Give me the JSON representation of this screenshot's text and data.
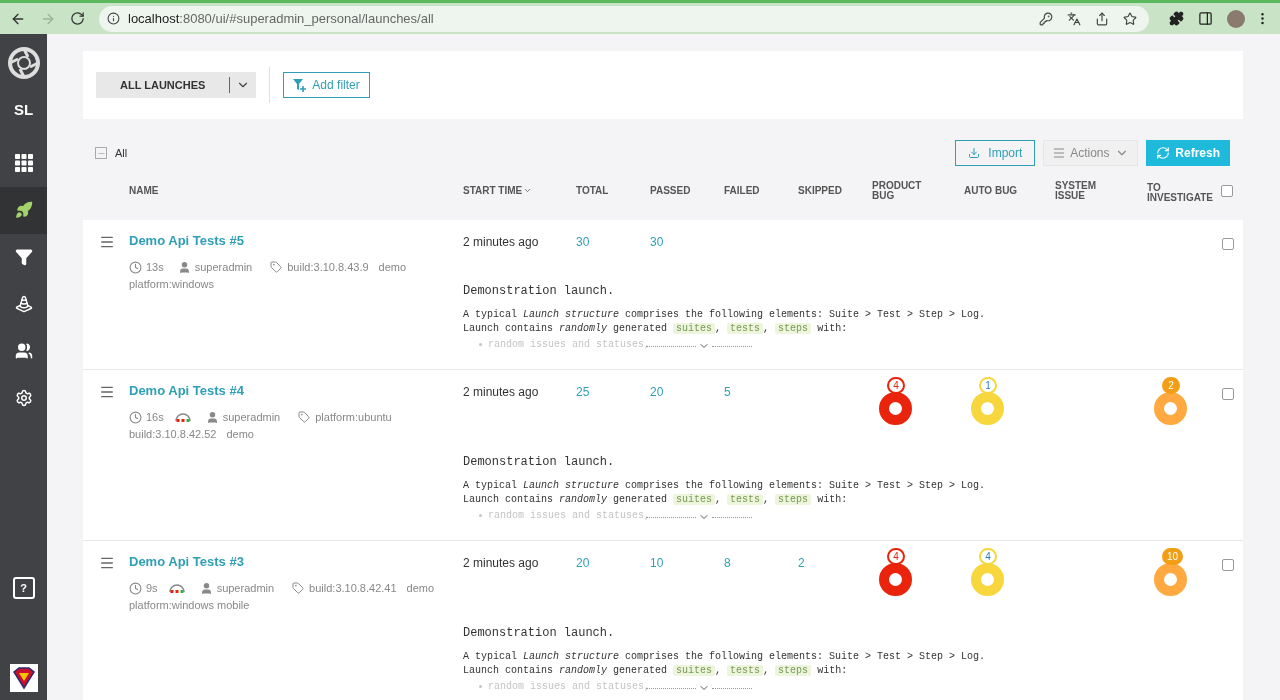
{
  "browser": {
    "url_host": "localhost",
    "url_path": ":8080/ui/#superadmin_personal/launches/all",
    "forward_disabled": true
  },
  "sidebar": {
    "project": "SL",
    "items": [
      {
        "kind": "grid",
        "selected": false
      },
      {
        "kind": "rocket",
        "selected": true
      },
      {
        "kind": "filter",
        "selected": false
      },
      {
        "kind": "cone",
        "selected": false
      },
      {
        "kind": "users",
        "selected": false
      },
      {
        "kind": "gear",
        "selected": false
      }
    ],
    "help": "?"
  },
  "filter_bar": {
    "dropdown": "ALL LAUNCHES",
    "add_filter": "Add filter"
  },
  "toolbar": {
    "select_all": {
      "label": "All",
      "checked": false
    },
    "import": "Import",
    "actions": "Actions",
    "refresh": "Refresh"
  },
  "table": {
    "columns": [
      {
        "label": "NAME",
        "sorted": false
      },
      {
        "label": "START TIME",
        "sorted": true
      },
      {
        "label": "TOTAL",
        "sorted": false
      },
      {
        "label": "PASSED",
        "sorted": false
      },
      {
        "label": "FAILED",
        "sorted": false
      },
      {
        "label": "SKIPPED",
        "sorted": false
      },
      {
        "label": "PRODUCT BUG",
        "sorted": false
      },
      {
        "label": "AUTO BUG",
        "sorted": false
      },
      {
        "label": "SYSTEM ISSUE",
        "sorted": false
      },
      {
        "label": "TO INVESTIGATE",
        "sorted": false
      }
    ],
    "header_checked": false,
    "rows": [
      {
        "name": "Demo Api Tests #5",
        "duration": "13s",
        "retries": false,
        "owner": "superadmin",
        "tags": [
          "build:3.10.8.43.9",
          "demo",
          "platform:windows"
        ],
        "start_time": "2 minutes ago",
        "total": "30",
        "passed": "30",
        "checked": false,
        "description": {
          "title": "Demonstration launch.",
          "line_1": "A typical *Launch structure* comprises the following elements: Suite > Test > Step > Log.",
          "line_2": [
            {
              "kind": "text",
              "text": "Launch contains "
            },
            {
              "kind": "italic",
              "text": "randomly"
            },
            {
              "kind": "text",
              "text": " generated "
            },
            {
              "kind": "code",
              "text": "suites"
            },
            {
              "kind": "text",
              "text": ", "
            },
            {
              "kind": "code",
              "text": "tests"
            },
            {
              "kind": "text",
              "text": ", "
            },
            {
              "kind": "code",
              "text": "steps"
            },
            {
              "kind": "text",
              "text": " with:"
            }
          ],
          "bullet": "random issues and statuses,"
        }
      },
      {
        "name": "Demo Api Tests #4",
        "duration": "16s",
        "retries": true,
        "owner": "superadmin",
        "tags": [
          "platform:ubuntu",
          "build:3.10.8.42.52",
          "demo"
        ],
        "start_time": "2 minutes ago",
        "total": "25",
        "passed": "20",
        "failed": "5",
        "product_bug": "4",
        "auto_bug": "1",
        "to_investigate": "2",
        "checked": false,
        "description": {
          "title": "Demonstration launch.",
          "line_1": "A typical *Launch structure* comprises the following elements: Suite > Test > Step > Log.",
          "line_2": [
            {
              "kind": "text",
              "text": "Launch contains "
            },
            {
              "kind": "italic",
              "text": "randomly"
            },
            {
              "kind": "text",
              "text": " generated "
            },
            {
              "kind": "code",
              "text": "suites"
            },
            {
              "kind": "text",
              "text": ", "
            },
            {
              "kind": "code",
              "text": "tests"
            },
            {
              "kind": "text",
              "text": ", "
            },
            {
              "kind": "code",
              "text": "steps"
            },
            {
              "kind": "text",
              "text": " with:"
            }
          ],
          "bullet": "random issues and statuses,"
        }
      },
      {
        "name": "Demo Api Tests #3",
        "duration": "9s",
        "retries": true,
        "owner": "superadmin",
        "tags": [
          "build:3.10.8.42.41",
          "demo",
          "platform:windows mobile"
        ],
        "start_time": "2 minutes ago",
        "total": "20",
        "passed": "10",
        "failed": "8",
        "skipped": "2",
        "product_bug": "4",
        "auto_bug": "4",
        "to_investigate": "10",
        "checked": false,
        "description": {
          "title": "Demonstration launch.",
          "line_1": "A typical *Launch structure* comprises the following elements: Suite > Test > Step > Log.",
          "line_2": [
            {
              "kind": "text",
              "text": "Launch contains "
            },
            {
              "kind": "italic",
              "text": "randomly"
            },
            {
              "kind": "text",
              "text": " generated "
            },
            {
              "kind": "code",
              "text": "suites"
            },
            {
              "kind": "text",
              "text": ", "
            },
            {
              "kind": "code",
              "text": "tests"
            },
            {
              "kind": "text",
              "text": ", "
            },
            {
              "kind": "code",
              "text": "steps"
            },
            {
              "kind": "text",
              "text": " with:"
            }
          ],
          "bullet": "random issues and statuses,"
        }
      }
    ]
  }
}
